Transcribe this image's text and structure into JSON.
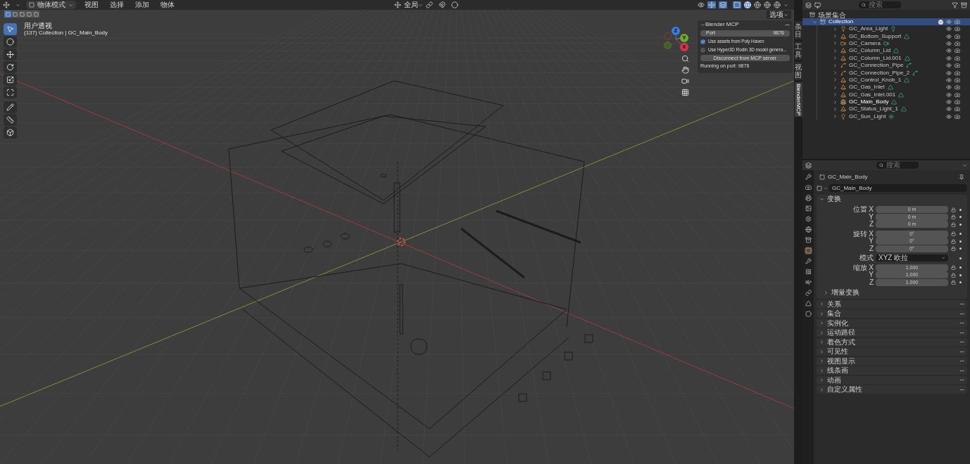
{
  "viewport": {
    "mode": "物体模式",
    "menus": [
      "视图",
      "选择",
      "添加",
      "物体"
    ],
    "orientation": "全局",
    "options": "选项",
    "select_modes": [
      {
        "selected": true
      },
      {
        "selected": false
      },
      {
        "selected": false
      },
      {
        "selected": false
      },
      {
        "selected": false
      }
    ],
    "shading_modes": [
      {
        "selected": true
      },
      {
        "selected": false
      },
      {
        "selected": false
      },
      {
        "selected": false
      }
    ],
    "view_name": "用户透视",
    "context": "(137) Collection | GC_Main_Body",
    "tools": [
      {
        "selected": true
      },
      {
        "selected": false
      },
      {
        "selected": false
      },
      {
        "selected": false
      },
      {
        "selected": false
      },
      {
        "selected": false
      },
      {
        "selected": false
      },
      {
        "selected": false
      },
      {
        "selected": false
      }
    ],
    "gizmo": {
      "axes": [
        {
          "kind": "z",
          "label": "Z"
        },
        {
          "kind": "y",
          "label": "Y"
        },
        {
          "kind": "x",
          "label": "X"
        }
      ]
    }
  },
  "mcp_panel": {
    "title": "Blender MCP",
    "port_label": "Port",
    "port_value": "9876",
    "options": [
      {
        "label": "Use assets from Poly Haven",
        "checked": true
      },
      {
        "label": "Use Hyper3D Rodin 3D model genera...",
        "checked": false
      }
    ],
    "button": "Disconnect from MCP server",
    "status": "Running on port: 9876"
  },
  "sidebar_tabs": [
    {
      "label": "条目",
      "selected": false
    },
    {
      "label": "工具",
      "selected": false
    },
    {
      "label": "视图",
      "selected": false
    },
    {
      "label": "BlenderMCP",
      "selected": true
    }
  ],
  "outliner": {
    "search_placeholder": "搜索",
    "root": "场景集合",
    "collection": {
      "name": "Collection",
      "selected": true,
      "checked": true,
      "expanded": true,
      "children": [
        {
          "name": "GC_Area_Light",
          "kind": "light",
          "active": false
        },
        {
          "name": "GC_Bottom_Support",
          "kind": "mesh",
          "active": false
        },
        {
          "name": "GC_Camera",
          "kind": "camera",
          "active": false
        },
        {
          "name": "GC_Column_Lid",
          "kind": "mesh",
          "active": false
        },
        {
          "name": "GC_Column_Lid.001",
          "kind": "mesh",
          "active": false
        },
        {
          "name": "GC_Connection_Pipe",
          "kind": "curve",
          "active": false
        },
        {
          "name": "GC_Connection_Pipe_2",
          "kind": "curve",
          "active": false
        },
        {
          "name": "GC_Control_Knob_1",
          "kind": "mesh",
          "active": false
        },
        {
          "name": "GC_Gas_Inlet",
          "kind": "mesh",
          "active": false
        },
        {
          "name": "GC_Gas_Inlet.001",
          "kind": "mesh",
          "active": false
        },
        {
          "name": "GC_Main_Body",
          "kind": "mesh",
          "active": true
        },
        {
          "name": "GC_Status_Light_1",
          "kind": "mesh",
          "active": false
        },
        {
          "name": "GC_Sun_Light",
          "kind": "sun",
          "active": false
        }
      ]
    }
  },
  "properties": {
    "search_placeholder": "搜索",
    "object_name": "GC_Main_Body",
    "name_field": "GC_Main_Body",
    "tabs": [
      {
        "selected": false
      },
      {
        "selected": false
      },
      {
        "selected": false
      },
      {
        "selected": false
      },
      {
        "selected": false
      },
      {
        "selected": false
      },
      {
        "selected": false
      },
      {
        "selected": true
      },
      {
        "selected": false
      },
      {
        "selected": false
      },
      {
        "selected": false
      },
      {
        "selected": false
      },
      {
        "selected": false
      },
      {
        "selected": false
      }
    ],
    "transform": {
      "title": "变换",
      "expanded": true,
      "rows": [
        {
          "kind": "field",
          "label": "位置",
          "axis": "X",
          "value": "0 m"
        },
        {
          "kind": "field",
          "axis": "Y",
          "value": "0 m"
        },
        {
          "kind": "field",
          "axis": "Z",
          "value": "0 m"
        },
        {
          "kind": "field",
          "label": "旋转",
          "axis": "X",
          "value": "0°"
        },
        {
          "kind": "field",
          "axis": "Y",
          "value": "0°"
        },
        {
          "kind": "field",
          "axis": "Z",
          "value": "0°"
        },
        {
          "kind": "dropdown",
          "label": "模式",
          "value": "XYZ 欧拉"
        },
        {
          "kind": "field",
          "label": "缩放",
          "axis": "X",
          "value": "1.000"
        },
        {
          "kind": "field",
          "axis": "Y",
          "value": "1.000"
        },
        {
          "kind": "field",
          "axis": "Z",
          "value": "1.000"
        }
      ],
      "subsection": "增量变换"
    },
    "sections": [
      {
        "title": "关系",
        "expanded": false
      },
      {
        "title": "集合",
        "expanded": false
      },
      {
        "title": "实例化",
        "expanded": false
      },
      {
        "title": "运动路径",
        "expanded": false
      },
      {
        "title": "着色方式",
        "expanded": false
      },
      {
        "title": "可见性",
        "expanded": false
      },
      {
        "title": "视图显示",
        "expanded": false
      },
      {
        "title": "线条画",
        "expanded": false
      },
      {
        "title": "动画",
        "expanded": false
      },
      {
        "title": "自定义属性",
        "expanded": false
      }
    ]
  }
}
